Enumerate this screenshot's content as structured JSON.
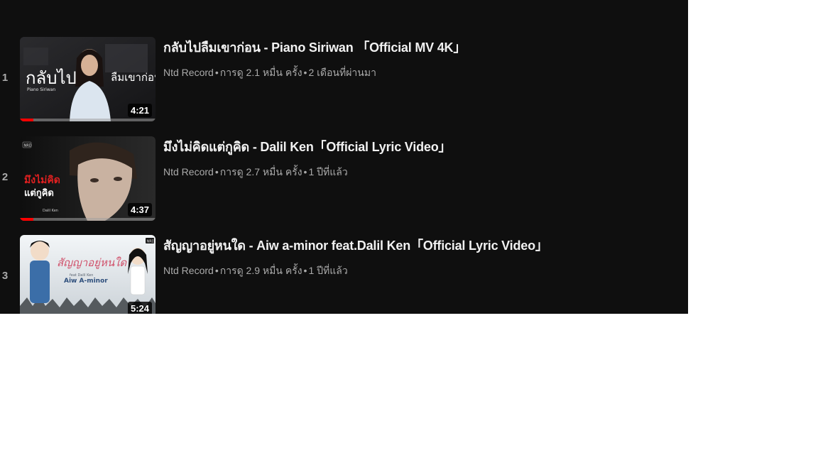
{
  "videos": [
    {
      "rank": "1",
      "title": "กลับไปลืมเขาก่อน - Piano Siriwan 「Official MV 4K」",
      "channel": "Ntd Record",
      "views": "การดู 2.1 หมื่น ครั้ง",
      "age": "2 เดือนที่ผ่านมา",
      "duration": "4:21",
      "progress": 0.1,
      "thumb_text_main": "กลับไป",
      "thumb_text_sub": "Piano Siriwan",
      "thumb_text_right": "ลืมเขาก่อน"
    },
    {
      "rank": "2",
      "title": "มึงไม่คิดแต่กูคิด - Dalil Ken「Official Lyric Video」",
      "channel": "Ntd Record",
      "views": "การดู 2.7 หมื่น ครั้ง",
      "age": "1 ปีที่แล้ว",
      "duration": "4:37",
      "progress": 0.1,
      "thumb_text_main": "มึงไม่คิด",
      "thumb_text_sub": "แต่กูคิด",
      "thumb_text_credit": "Dalil Ken",
      "thumb_badge": "NRD"
    },
    {
      "rank": "3",
      "title": "สัญญาอยู่หนใด - Aiw a-minor feat.Dalil Ken「Official Lyric Video」",
      "channel": "Ntd Record",
      "views": "การดู 2.9 หมื่น ครั้ง",
      "age": "1 ปีที่แล้ว",
      "duration": "5:24",
      "thumb_text_main": "สัญญาอยู่หนใด",
      "thumb_text_feat": "feat Dalil Ken",
      "thumb_text_artist": "Aiw A-minor",
      "thumb_badge": "NRD"
    }
  ],
  "meta_separator": "•",
  "colors": {
    "background": "#0f0f0f",
    "title": "#f1f1f1",
    "meta": "#aaaaaa",
    "progress": "#ff0000"
  }
}
